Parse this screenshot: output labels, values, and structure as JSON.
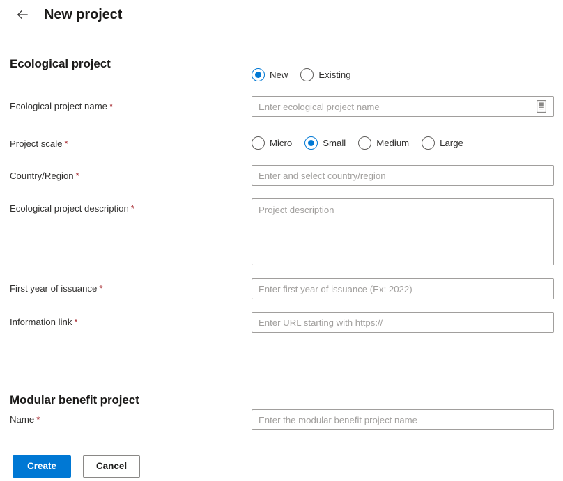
{
  "header": {
    "back_icon": "arrow-left-icon",
    "title": "New project"
  },
  "sections": {
    "ecological": {
      "title": "Ecological project",
      "mode_radio": {
        "name": "project-mode",
        "selected": "New",
        "options": [
          {
            "label": "New",
            "checked": true
          },
          {
            "label": "Existing",
            "checked": false
          }
        ]
      },
      "fields": {
        "project_name": {
          "label": "Ecological project name",
          "required": "*",
          "placeholder": "Enter ecological project name",
          "value": "",
          "icon": "document-picker-icon"
        },
        "project_scale": {
          "label": "Project scale",
          "required": "*",
          "selected": "Small",
          "options": [
            {
              "label": "Micro",
              "checked": false
            },
            {
              "label": "Small",
              "checked": true
            },
            {
              "label": "Medium",
              "checked": false
            },
            {
              "label": "Large",
              "checked": false
            }
          ]
        },
        "country_region": {
          "label": "Country/Region",
          "required": "*",
          "placeholder": "Enter and select country/region",
          "value": ""
        },
        "description": {
          "label": "Ecological project description",
          "required": "*",
          "placeholder": "Project description",
          "value": ""
        },
        "first_year": {
          "label": "First year of issuance",
          "required": "*",
          "placeholder": "Enter first year of issuance (Ex: 2022)",
          "value": ""
        },
        "information_link": {
          "label": "Information link",
          "required": "*",
          "placeholder": "Enter URL starting with https://",
          "value": ""
        }
      }
    },
    "modular": {
      "title": "Modular benefit project",
      "fields": {
        "name": {
          "label": "Name",
          "required": "*",
          "placeholder": "Enter the modular benefit project name",
          "value": ""
        }
      }
    }
  },
  "footer": {
    "create_label": "Create",
    "cancel_label": "Cancel"
  },
  "colors": {
    "accent": "#0078d4",
    "required_asterisk": "#a4262c",
    "border": "#a19f9d",
    "divider": "#e1dfdd",
    "text": "#323130"
  }
}
